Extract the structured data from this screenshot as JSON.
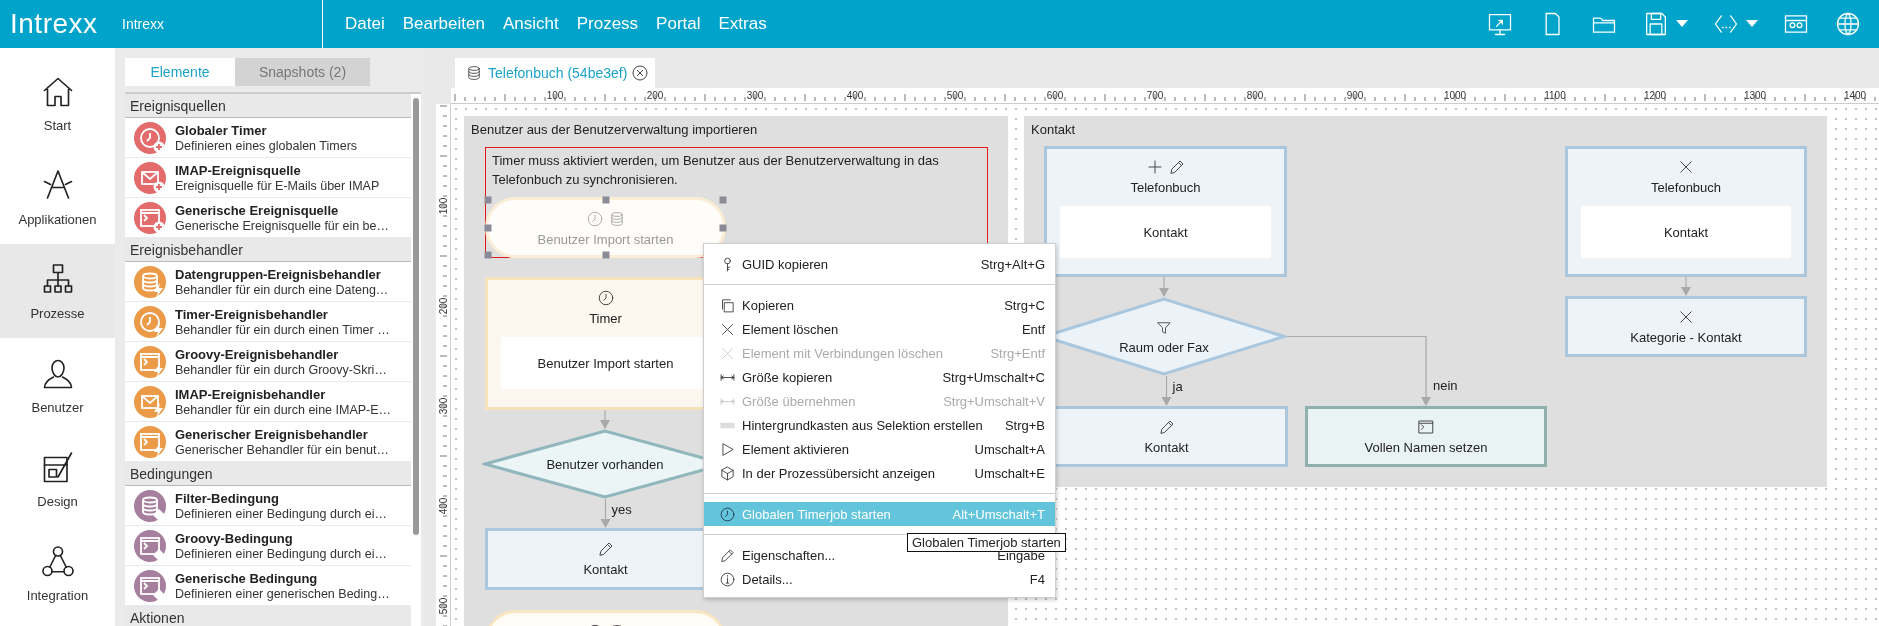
{
  "app": {
    "logo": "Intrexx",
    "name": "Intrexx"
  },
  "menu_bar": [
    "Datei",
    "Bearbeiten",
    "Ansicht",
    "Prozess",
    "Portal",
    "Extras"
  ],
  "toolbar": [
    {
      "kind": "monitor",
      "dropdown": false
    },
    {
      "kind": "document",
      "dropdown": false
    },
    {
      "kind": "folder",
      "dropdown": false
    },
    {
      "kind": "save",
      "dropdown": true
    },
    {
      "kind": "code",
      "dropdown": true
    },
    {
      "kind": "cassette",
      "dropdown": false
    },
    {
      "kind": "globe",
      "dropdown": false
    }
  ],
  "nav": [
    {
      "label": "Start",
      "kind": "home",
      "selected": false
    },
    {
      "label": "Applikationen",
      "kind": "apps",
      "selected": false
    },
    {
      "label": "Prozesse",
      "kind": "org",
      "selected": true
    },
    {
      "label": "Benutzer",
      "kind": "person",
      "selected": false
    },
    {
      "label": "Design",
      "kind": "design",
      "selected": false
    },
    {
      "label": "Integration",
      "kind": "integration",
      "selected": false
    }
  ],
  "panel": {
    "tabs": [
      {
        "label": "Elemente",
        "selected": true
      },
      {
        "label": "Snapshots (2)",
        "selected": false
      }
    ],
    "groups": [
      {
        "title": "Ereignisquellen",
        "color": "#e36b6b",
        "badge": {
          "kind": "plus"
        },
        "items": [
          {
            "kind": "clock",
            "title": "Globaler Timer",
            "description": "Definieren eines globalen Timers"
          },
          {
            "kind": "mail",
            "title": "IMAP-Ereignisquelle",
            "description": "Ereignisquelle für E-Mails über IMAP"
          },
          {
            "kind": "script",
            "title": "Generische Ereignisquelle",
            "description": "Generische Ereignisquelle für ein be…"
          }
        ]
      },
      {
        "title": "Ereignisbehandler",
        "color": "#eb9a48",
        "badge": {
          "kind": "bolt"
        },
        "items": [
          {
            "kind": "database",
            "title": "Datengruppen-Ereignisbehandler",
            "description": "Behandler für ein durch eine Dateng…"
          },
          {
            "kind": "clock",
            "title": "Timer-Ereignisbehandler",
            "description": "Behandler für ein durch einen Timer …"
          },
          {
            "kind": "script",
            "title": "Groovy-Ereignisbehandler",
            "description": "Behandler für ein durch Groovy-Skri…"
          },
          {
            "kind": "mail",
            "title": "IMAP-Ereignisbehandler",
            "description": "Behandler für ein durch eine IMAP-E…"
          },
          {
            "kind": "script",
            "title": "Generischer Ereignisbehandler",
            "description": "Generischer Behandler für ein benut…"
          }
        ]
      },
      {
        "title": "Bedingungen",
        "color": "#a67f9f",
        "badge": {
          "kind": "diamond"
        },
        "items": [
          {
            "kind": "database",
            "title": "Filter-Bedingung",
            "description": "Definieren einer Bedingung durch ei…"
          },
          {
            "kind": "script",
            "title": "Groovy-Bedingung",
            "description": "Definieren einer Bedingung durch ei…"
          },
          {
            "kind": "script",
            "title": "Generische Bedingung",
            "description": "Definieren einer generischen Beding…"
          }
        ]
      },
      {
        "title": "Aktionen"
      }
    ]
  },
  "editor_tab": {
    "title": "Telefonbuch (54be3ef)"
  },
  "rulers": {
    "horizontal": [
      "100",
      "200",
      "300",
      "400",
      "500",
      "600",
      "700",
      "800",
      "900",
      "1000",
      "1100",
      "1200",
      "1300",
      "1400"
    ],
    "vertical": [
      "100",
      "200",
      "300",
      "400",
      "500"
    ]
  },
  "canvas": {
    "groups": [
      {
        "title": "Benutzer aus der Benutzerverwaltung importieren",
        "comment": "Timer muss aktiviert werden, um Benutzer aus der Benutzerverwaltung in das Telefonbuch zu synchronisieren.",
        "nodes": [
          {
            "kind": "event",
            "icons": [
              {
                "kind": "clock"
              },
              {
                "kind": "database"
              }
            ],
            "title": "Benutzer Import starten",
            "selected": true
          },
          {
            "kind": "timer",
            "icons": [
              {
                "kind": "clock"
              }
            ],
            "title": "Timer",
            "detail": "Benutzer Import starten",
            "selected": false
          },
          {
            "kind": "decision",
            "title": "Benutzer vorhanden",
            "selected": false
          },
          {
            "kind": "data",
            "icons": [
              {
                "kind": "pencil"
              }
            ],
            "title": "Kontakt",
            "in_label": "yes",
            "selected": false
          },
          {
            "kind": "event",
            "icons": [
              {
                "kind": "clock"
              },
              {
                "kind": "database"
              }
            ],
            "selected": false
          }
        ]
      },
      {
        "title": "Kontakt",
        "nodes": [
          {
            "kind": "data",
            "icons": [
              {
                "kind": "plus"
              },
              {
                "kind": "pencil"
              }
            ],
            "title": "Telefonbuch",
            "detail": "Kontakt",
            "selected": false
          },
          {
            "kind": "decision",
            "icons": [
              {
                "kind": "filter"
              }
            ],
            "title": "Raum oder Fax",
            "selected": false
          },
          {
            "kind": "data",
            "icons": [
              {
                "kind": "pencil"
              }
            ],
            "title": "Kontakt",
            "in_label": "ja",
            "selected": false
          },
          {
            "kind": "script",
            "icons": [
              {
                "kind": "script"
              }
            ],
            "title": "Vollen Namen setzen",
            "in_label": "nein",
            "selected": false
          },
          {
            "kind": "data",
            "icons": [
              {
                "kind": "x"
              }
            ],
            "title": "Telefonbuch",
            "detail": "Kontakt",
            "selected": false
          },
          {
            "kind": "data",
            "icons": [
              {
                "kind": "x"
              }
            ],
            "title": "Kategorie - Kontakt",
            "selected": false
          }
        ]
      }
    ]
  },
  "context_menu": {
    "groups": [
      [
        {
          "kind": "key",
          "label": "GUID kopieren",
          "shortcut": "Strg+Alt+G",
          "disabled": false,
          "selected": false
        }
      ],
      [
        {
          "kind": "copy",
          "label": "Kopieren",
          "shortcut": "Strg+C",
          "disabled": false,
          "selected": false
        },
        {
          "kind": "x",
          "label": "Element löschen",
          "shortcut": "Entf",
          "disabled": false,
          "selected": false
        },
        {
          "kind": "x",
          "label": "Element mit Verbindungen löschen",
          "shortcut": "Strg+Entf",
          "disabled": true,
          "selected": false
        },
        {
          "kind": "width",
          "label": "Größe kopieren",
          "shortcut": "Strg+Umschalt+C",
          "disabled": false,
          "selected": false
        },
        {
          "kind": "width",
          "label": "Größe übernehmen",
          "shortcut": "Strg+Umschalt+V",
          "disabled": true,
          "selected": false
        },
        {
          "kind": "rect",
          "label": "Hintergrundkasten aus Selektion erstellen",
          "shortcut": "Strg+B",
          "disabled": false,
          "selected": false
        },
        {
          "kind": "play",
          "label": "Element aktivieren",
          "shortcut": "Umschalt+A",
          "disabled": false,
          "selected": false
        },
        {
          "kind": "cube",
          "label": "In der Prozessübersicht anzeigen",
          "shortcut": "Umschalt+E",
          "disabled": false,
          "selected": false
        }
      ],
      [
        {
          "kind": "clock",
          "label": "Globalen Timerjob starten",
          "shortcut": "Alt+Umschalt+T",
          "disabled": false,
          "selected": true
        }
      ],
      [
        {
          "kind": "pencil",
          "label": "Eigenschaften...",
          "shortcut": "Eingabe",
          "disabled": false,
          "selected": false
        },
        {
          "kind": "info",
          "label": "Details...",
          "shortcut": "F4",
          "disabled": false,
          "selected": false
        }
      ]
    ]
  },
  "tooltip": "Globalen Timerjob starten"
}
